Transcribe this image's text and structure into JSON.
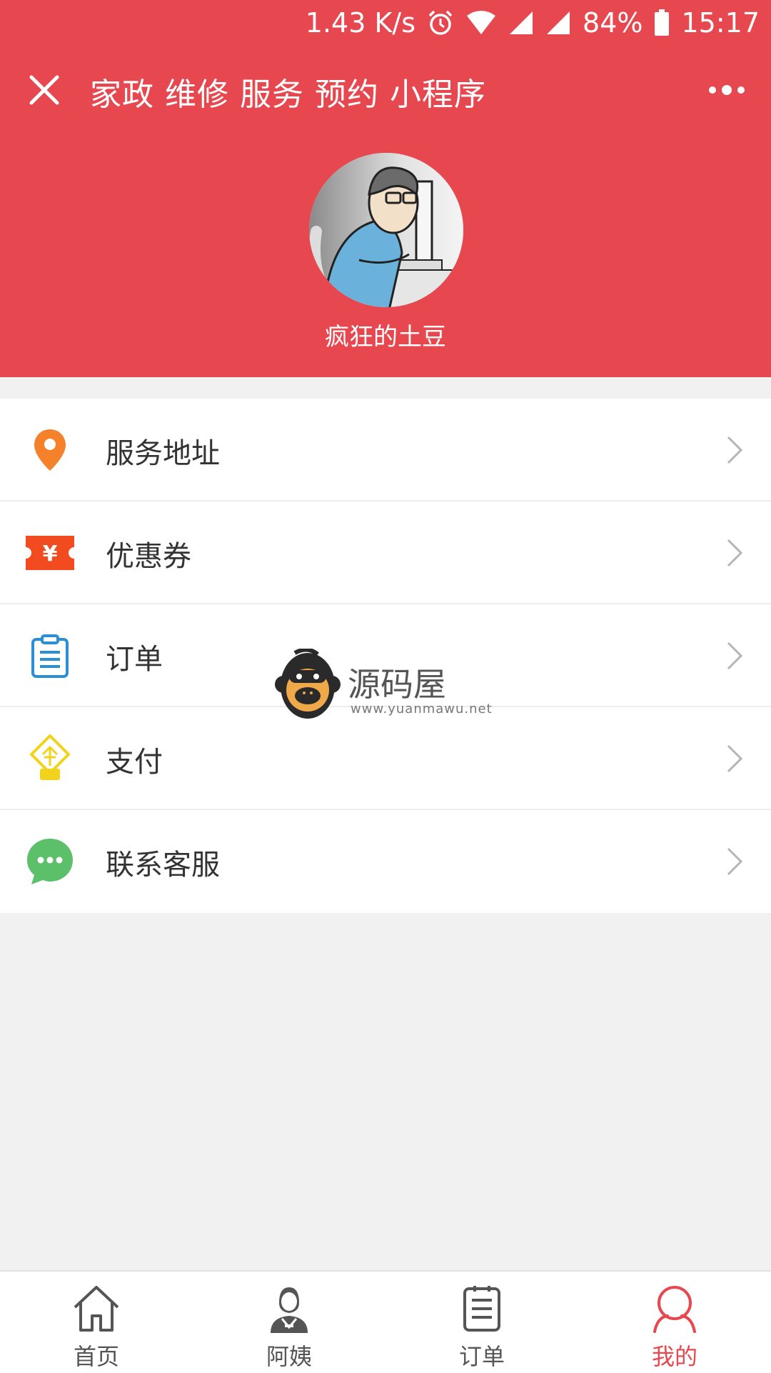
{
  "status_bar": {
    "network_speed": "1.43 K/s",
    "battery": "84%",
    "time": "15:17",
    "icons": [
      "alarm-icon",
      "wifi-icon",
      "signal-icon",
      "signal-icon",
      "battery-icon"
    ]
  },
  "nav": {
    "title": "家政 维修 服务 预约 小程序",
    "close_icon": "close-icon",
    "more_icon": "more-icon"
  },
  "profile": {
    "username": "疯狂的土豆"
  },
  "menu": {
    "items": [
      {
        "label": "服务地址",
        "icon": "location-pin-icon",
        "color": "#f5822a"
      },
      {
        "label": "优惠券",
        "icon": "coupon-icon",
        "color": "#f24b1f"
      },
      {
        "label": "订单",
        "icon": "clipboard-icon",
        "color": "#2a8fd6"
      },
      {
        "label": "支付",
        "icon": "payment-icon",
        "color": "#f2d31c"
      },
      {
        "label": "联系客服",
        "icon": "chat-icon",
        "color": "#5cbf6a"
      }
    ]
  },
  "watermark": {
    "title": "源码屋",
    "url": "www.yuanmawu.net"
  },
  "tabbar": {
    "tabs": [
      {
        "label": "首页",
        "icon": "home-icon",
        "active": false
      },
      {
        "label": "阿姨",
        "icon": "person-icon",
        "active": false
      },
      {
        "label": "订单",
        "icon": "list-icon",
        "active": false
      },
      {
        "label": "我的",
        "icon": "user-icon",
        "active": true
      }
    ]
  },
  "colors": {
    "brand": "#e7474f",
    "background": "#f1f1f1"
  }
}
